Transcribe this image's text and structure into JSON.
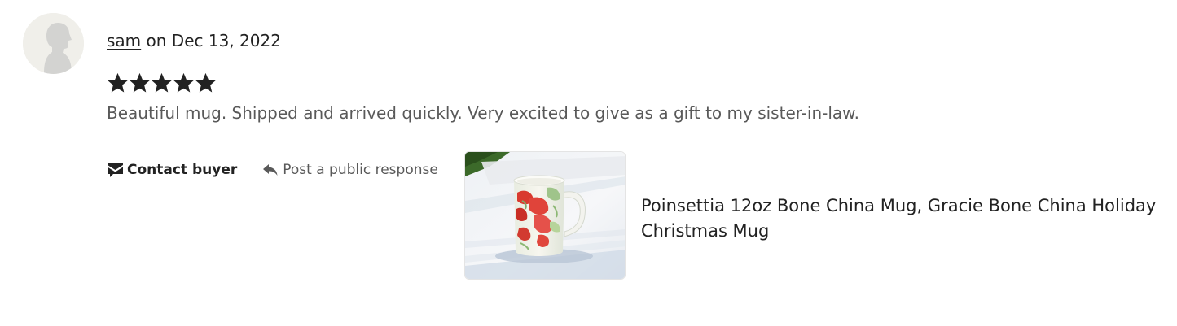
{
  "review": {
    "reviewer_name": "sam",
    "date_text": " on Dec 13, 2022",
    "rating": 5,
    "rating_max": 5,
    "text": "Beautiful mug. Shipped and arrived quickly. Very excited to give as a gift to my sister-in-law."
  },
  "actions": {
    "contact_label": "Contact buyer",
    "contact_icon": "envelope-icon",
    "respond_label": "Post a public response",
    "respond_icon": "reply-arrow-icon"
  },
  "listing": {
    "title": "Poinsettia 12oz Bone China Mug, Gracie Bone China Holiday Christmas Mug"
  },
  "colors": {
    "text_primary": "#222222",
    "text_secondary": "#595959",
    "star": "#222222",
    "avatar_bg": "#f0efea",
    "avatar_figure": "#d3d3d1"
  }
}
